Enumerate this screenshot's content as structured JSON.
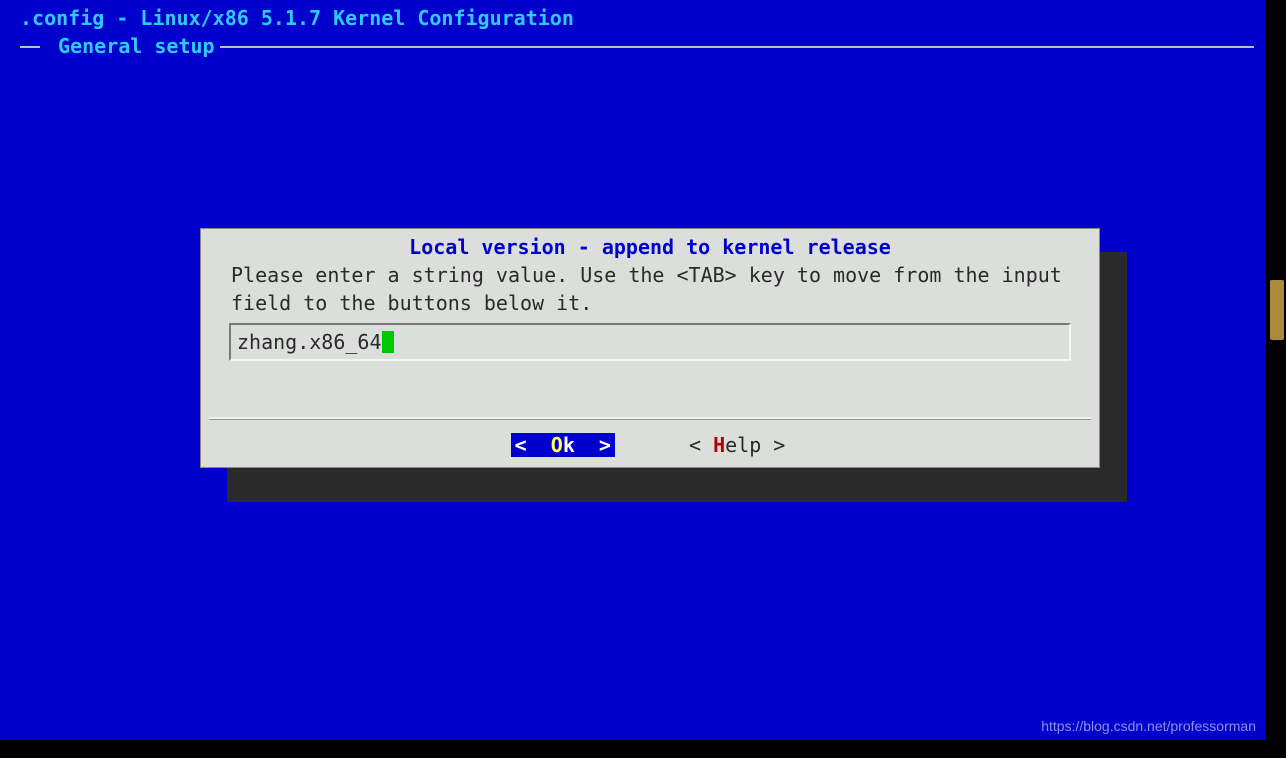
{
  "header": {
    "title": ".config - Linux/x86 5.1.7 Kernel Configuration",
    "section": " General setup "
  },
  "dialog": {
    "title": "Local version - append to kernel release",
    "prompt": "Please enter a string value. Use the <TAB> key to move from the input field to the buttons below it.",
    "input_value": "zhang.x86_64"
  },
  "buttons": {
    "ok": {
      "open": "<  ",
      "hot": "O",
      "rest": "k  >"
    },
    "help": {
      "open": "< ",
      "hot": "H",
      "rest": "elp >"
    }
  },
  "watermark": "https://blog.csdn.net/professorman"
}
